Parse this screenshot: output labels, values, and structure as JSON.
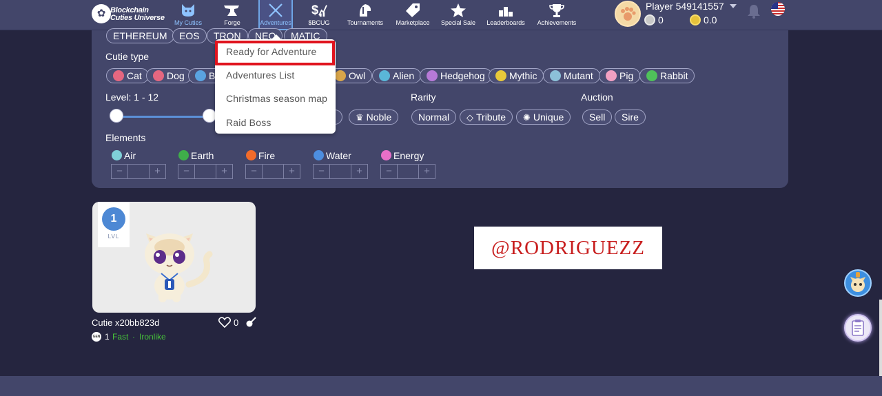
{
  "header": {
    "logo_line1": "Blockchain",
    "logo_line2": "Cuties Universe",
    "nav": [
      {
        "label": "My Cuties",
        "icon": "cat-face-icon"
      },
      {
        "label": "Forge",
        "icon": "anvil-icon"
      },
      {
        "label": "Adventures",
        "icon": "crossed-swords-icon"
      },
      {
        "label": "$BCUG",
        "icon": "dollar-chart-icon"
      },
      {
        "label": "Tournaments",
        "icon": "helmet-icon"
      },
      {
        "label": "Marketplace",
        "icon": "tag-icon"
      },
      {
        "label": "Special Sale",
        "icon": "star-icon"
      },
      {
        "label": "Leaderboards",
        "icon": "podium-icon"
      },
      {
        "label": "Achievements",
        "icon": "trophy-icon"
      }
    ],
    "player_name": "Player 549141557",
    "silver_balance": "0",
    "gold_balance": "0.0"
  },
  "filters": {
    "chains": [
      "ETHEREUM",
      "EOS",
      "TRON",
      "NEO",
      "MATIC"
    ],
    "cutie_type_label": "Cutie type",
    "types": [
      "Cat",
      "Dog",
      "Be",
      "Owl",
      "Alien",
      "Hedgehog",
      "Mythic",
      "Mutant",
      "Pig",
      "Rabbit"
    ],
    "level_label": "Level: 1 - 12",
    "level_range": [
      1,
      12
    ],
    "rarity_label": "Rarity",
    "rarity_partial": [
      "al",
      "Noble"
    ],
    "rarity": [
      "Normal",
      "Tribute",
      "Unique"
    ],
    "auction_label": "Auction",
    "auction": [
      "Sell",
      "Sire"
    ],
    "elements_label": "Elements",
    "elements": [
      {
        "name": "Air",
        "color": "#7fd0d8"
      },
      {
        "name": "Earth",
        "color": "#3fae4a"
      },
      {
        "name": "Fire",
        "color": "#f26b2a"
      },
      {
        "name": "Water",
        "color": "#4d8ee0"
      },
      {
        "name": "Energy",
        "color": "#e86fc8"
      }
    ],
    "stepper_minus": "−",
    "stepper_plus": "+"
  },
  "dropdown": {
    "items": [
      "Ready for Adventure",
      "Adventures List",
      "Christmas season map",
      "Raid Boss"
    ]
  },
  "card": {
    "level": "1",
    "level_text": "LVL",
    "name": "Cutie x20bb823d",
    "likes": "0",
    "gen_badge": "GEN",
    "generation": "1",
    "trait1": "Fast",
    "trait_sep": "·",
    "trait2": "Ironlike"
  },
  "watermark": "@RODRIGUEZZ",
  "colors": {
    "bg": "#25253f",
    "panel": "#43466a",
    "accent": "#5c90d8",
    "highlight": "#e0141e",
    "trait_green": "#46c23a"
  }
}
